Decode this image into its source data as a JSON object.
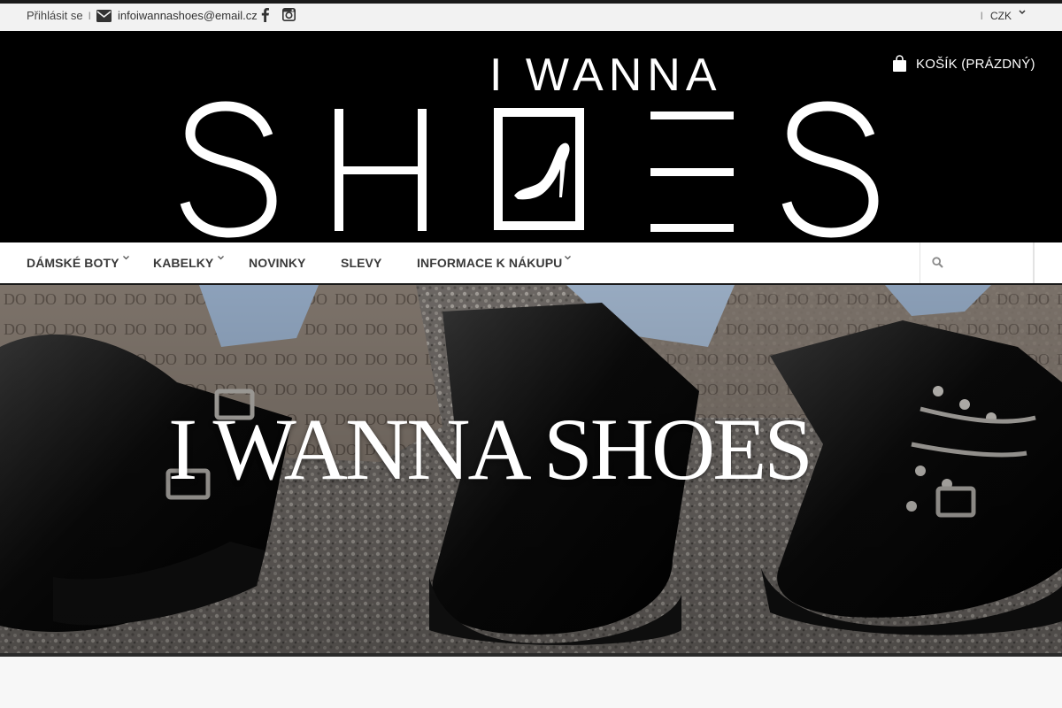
{
  "topbar": {
    "login_label": "Přihlásit se",
    "separator": "|",
    "email": "infoiwannashoes@email.cz",
    "icons": [
      "envelope-icon",
      "facebook-icon",
      "instagram-icon"
    ],
    "currency": "CZK"
  },
  "header": {
    "logo_top": "I WANNA",
    "logo_bottom": "SHOES",
    "cart_label": "KOŠÍK (PRÁZDNÝ)"
  },
  "nav": {
    "items": [
      {
        "label": "DÁMSKÉ BOTY",
        "has_dropdown": true
      },
      {
        "label": "KABELKY",
        "has_dropdown": true
      },
      {
        "label": "NOVINKY",
        "has_dropdown": false
      },
      {
        "label": "SLEVY",
        "has_dropdown": false
      },
      {
        "label": "INFORMACE K NÁKUPU",
        "has_dropdown": true
      }
    ],
    "search_placeholder": ""
  },
  "hero": {
    "title": "I WANNA SHOES"
  },
  "colors": {
    "header_bg": "#000000",
    "topbar_bg": "#f2f2f2",
    "nav_text": "#3a3a3a",
    "accent_line": "#1a1a1a"
  }
}
